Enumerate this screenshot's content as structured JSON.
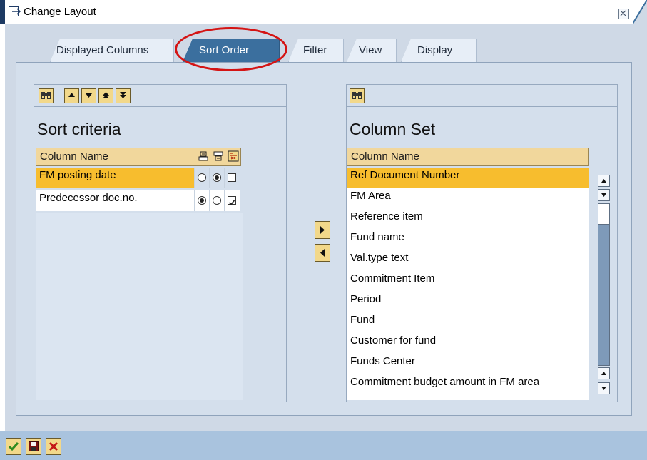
{
  "window": {
    "title": "Change Layout",
    "close_label": "⊠"
  },
  "tabs": [
    {
      "label": "Displayed Columns",
      "active": false
    },
    {
      "label": "Sort Order",
      "active": true
    },
    {
      "label": "Filter",
      "active": false
    },
    {
      "label": "View",
      "active": false
    },
    {
      "label": "Display",
      "active": false
    }
  ],
  "sort_panel": {
    "title": "Sort criteria",
    "column_header": "Column Name",
    "header_icons": [
      "sort-ascending-icon",
      "sort-descending-icon",
      "subtotal-icon"
    ],
    "toolbar_icons": [
      "find-icon",
      "move-up-icon",
      "move-down-icon",
      "move-top-icon",
      "move-bottom-icon"
    ],
    "rows": [
      {
        "name": "FM posting date",
        "ascending": false,
        "descending": true,
        "subtotal": false,
        "selected": true
      },
      {
        "name": "Predecessor doc.no.",
        "ascending": true,
        "descending": false,
        "subtotal": true,
        "selected": false
      }
    ]
  },
  "column_panel": {
    "title": "Column Set",
    "column_header": "Column Name",
    "toolbar_icons": [
      "find-icon"
    ],
    "items": [
      "Ref Document Number",
      "FM Area",
      "Reference item",
      "Fund name",
      "Val.type text",
      "Commitment Item",
      "Period",
      "Fund",
      "Customer for fund",
      "Funds Center",
      "Commitment budget amount in FM area"
    ],
    "selected_index": 0
  },
  "move_buttons": [
    "move-right-icon",
    "move-left-icon"
  ],
  "bottom_buttons": [
    "confirm-icon",
    "save-icon",
    "cancel-icon"
  ],
  "colors": {
    "selected_row": "#f7bd2e",
    "active_tab": "#3b6f9e",
    "highlight_circle": "#d41414"
  }
}
